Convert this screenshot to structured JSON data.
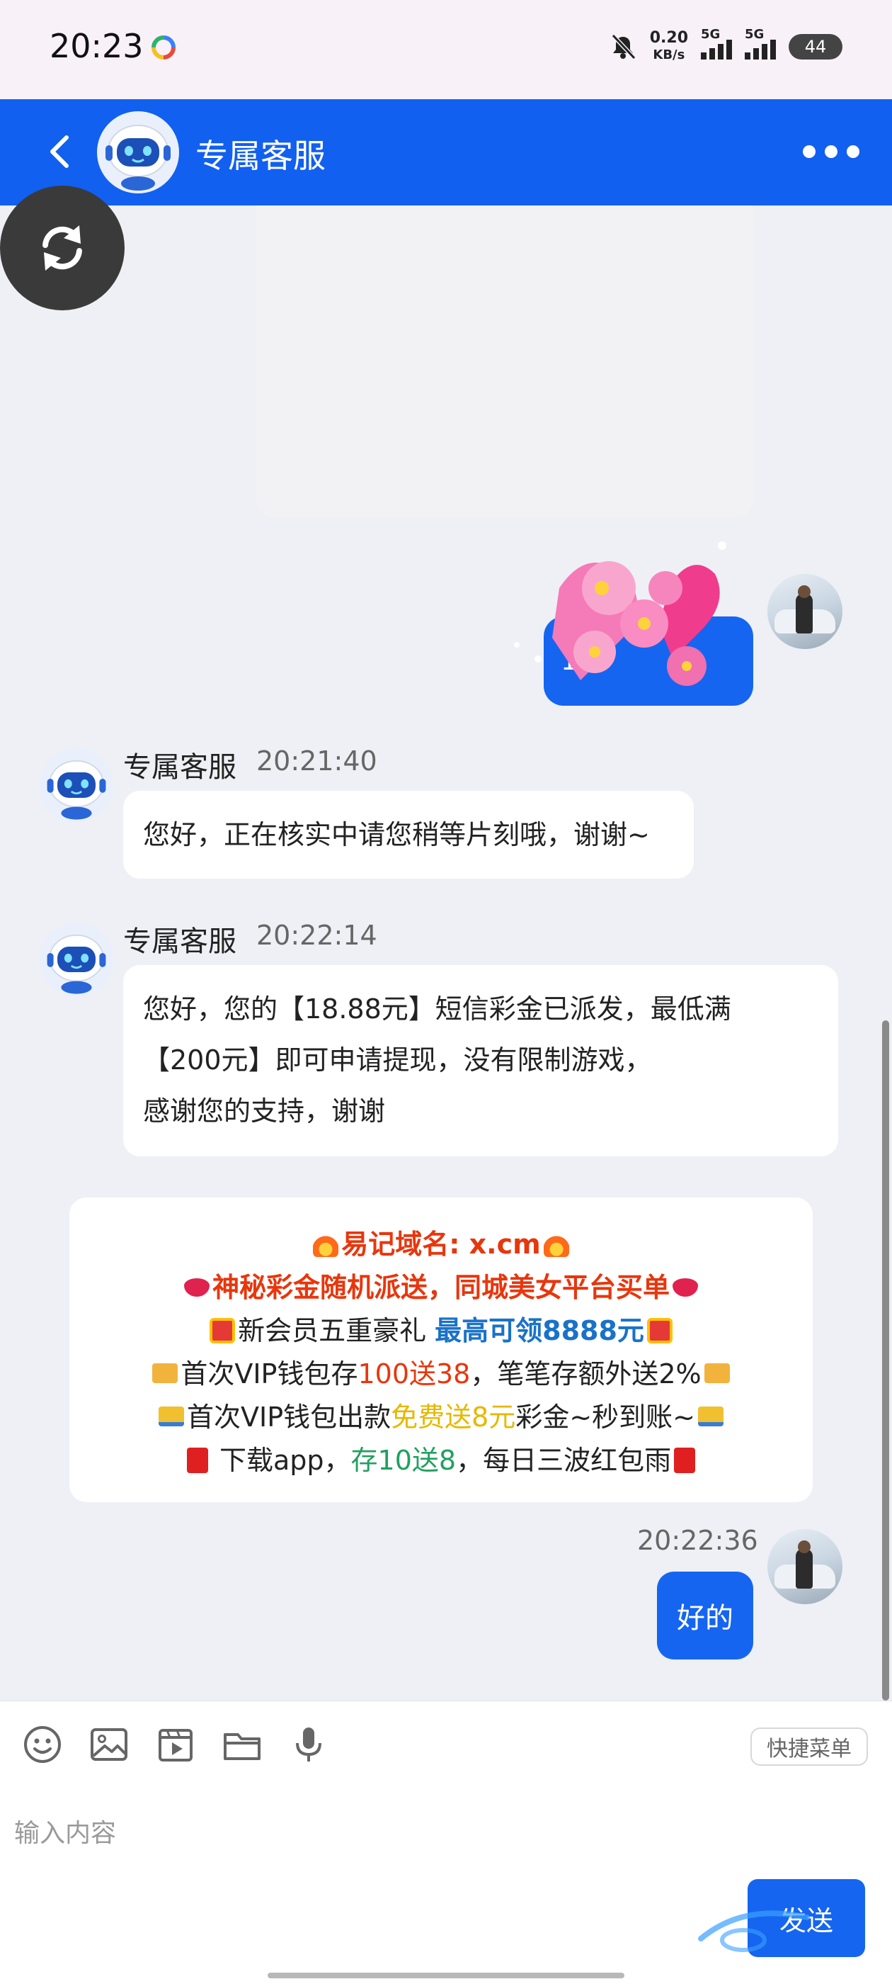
{
  "status_bar": {
    "time": "20:23",
    "net_speed_value": "0.20",
    "net_speed_unit": "KB/s",
    "sim1": "5G",
    "sim2": "5G",
    "battery": "44"
  },
  "header": {
    "title": "专属客服",
    "back_icon": "chevron-left-icon",
    "more_icon": "more-horizontal-icon"
  },
  "sticker": {
    "number": "15"
  },
  "messages": [
    {
      "sender": "专属客服",
      "time": "20:21:40",
      "lines": [
        "您好，正在核实中请您稍等片刻哦，谢谢~"
      ]
    },
    {
      "sender": "专属客服",
      "time": "20:22:14",
      "lines": [
        "您好，您的【18.88元】短信彩金已派发，最低满",
        "【200元】即可申请提现，没有限制游戏，",
        "感谢您的支持，谢谢"
      ]
    }
  ],
  "promo": {
    "line1": "易记域名: x.cm",
    "line2": "神秘彩金随机派送，同城美女平台买单",
    "line3_a": "新会员五重豪礼 ",
    "line3_b": "最高可领8888元",
    "line4_a": "首次VIP钱包存",
    "line4_b": "100送38",
    "line4_c": "，笔笔存额外送2%",
    "line5_a": "首次VIP钱包出款",
    "line5_b": "免费送8元",
    "line5_c": "彩金~秒到账~",
    "line6_a": " 下载app，",
    "line6_b": "存10送8",
    "line6_c": "，每日三波红包雨",
    "colors": {
      "red": "#e8360d",
      "blue": "#1a72c8",
      "yellow": "#e6b800",
      "green": "#22a060"
    }
  },
  "my_reply": {
    "time": "20:22:36",
    "text": "好的"
  },
  "toolbar": {
    "tools": [
      "emoji-icon",
      "image-icon",
      "video-icon",
      "folder-icon",
      "microphone-icon"
    ],
    "quick_menu": "快捷菜单"
  },
  "input": {
    "placeholder": "输入内容",
    "send_label": "发送"
  },
  "colors": {
    "primary": "#1160f0",
    "bubble_blue": "#1565f0",
    "background": "#eef0f5"
  }
}
